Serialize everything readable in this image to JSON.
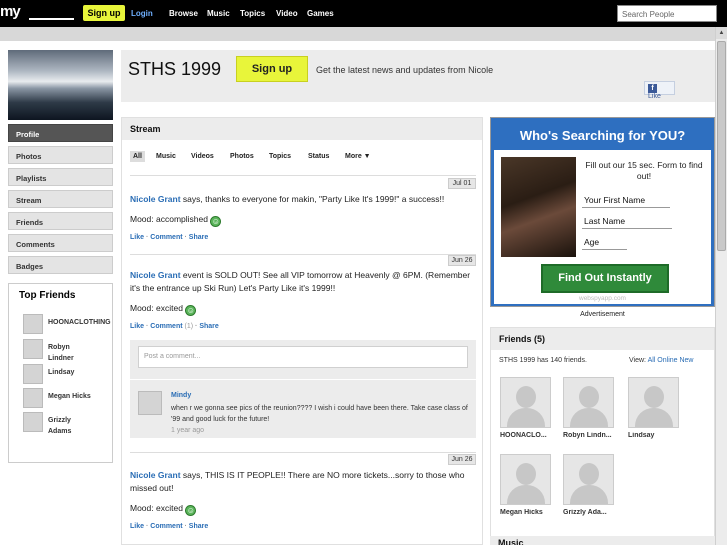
{
  "topbar": {
    "logo": "my",
    "signup": "Sign up",
    "login": "Login",
    "nav": [
      "Browse",
      "Music",
      "Topics",
      "Video",
      "Games"
    ],
    "search_placeholder": "Search People"
  },
  "profile": {
    "left_nav": [
      "Profile",
      "Photos",
      "Playlists",
      "Stream",
      "Friends",
      "Comments",
      "Badges"
    ],
    "active_nav": "Profile"
  },
  "top_friends": {
    "title": "Top Friends",
    "items": [
      "HOONACLOTHING",
      "Robyn Lindner",
      "Lindsay",
      "Megan Hicks",
      "Grizzly Adams"
    ]
  },
  "header": {
    "title": "STHS 1999",
    "signup": "Sign up",
    "tagline": "Get the latest news and updates from Nicole",
    "like": "Like"
  },
  "stream": {
    "title": "Stream",
    "filters": [
      "All",
      "Music",
      "Videos",
      "Photos",
      "Topics",
      "Status",
      "More ▼"
    ],
    "posts": [
      {
        "date": "Jul 01",
        "author": "Nicole Grant",
        "text": " says, thanks to everyone for makin, \"Party Like It's 1999!\" a success!!",
        "mood": "Mood: accomplished",
        "like": "Like",
        "comment": "Comment",
        "share": "Share"
      },
      {
        "date": "Jun 26",
        "author": "Nicole Grant",
        "text": " event is SOLD OUT! See all VIP tomorrow at Heavenly @ 6PM. (Remember it's the entrance up Ski Run) Let's Party Like it's 1999!!",
        "mood": "Mood: excited",
        "like": "Like",
        "comment": "Comment",
        "comment_count": "(1)",
        "share": "Share"
      },
      {
        "date": "Jun 26",
        "author": "Nicole Grant",
        "text": " says, THIS IS IT PEOPLE!! There are NO more tickets...sorry to those who missed out!",
        "mood": "Mood: excited",
        "like": "Like",
        "comment": "Comment",
        "share": "Share"
      }
    ],
    "comment_placeholder": "Post a comment...",
    "comment": {
      "author": "Mindy",
      "text": "when r we gonna see pics of the reunion???? I wish i could have been there. Take case class of '99 and good luck for the future!",
      "time": "1 year ago"
    }
  },
  "ad": {
    "title": "Who's Searching for YOU?",
    "text": "Fill out our 15 sec. Form to find out!",
    "fields": [
      "Your First Name",
      "Last Name",
      "Age"
    ],
    "cta": "Find Out Instantly",
    "url": "webspyapp.com",
    "label": "Advertisement"
  },
  "friends": {
    "title": "Friends (5)",
    "count_text": "STHS 1999 has 140 friends.",
    "view_label": "View:",
    "view_links": [
      "All",
      "Online",
      "New"
    ],
    "items": [
      "HOONACLO...",
      "Robyn Lindn...",
      "Lindsay",
      "Megan Hicks",
      "Grizzly Ada..."
    ]
  },
  "music": {
    "title": "Music"
  }
}
